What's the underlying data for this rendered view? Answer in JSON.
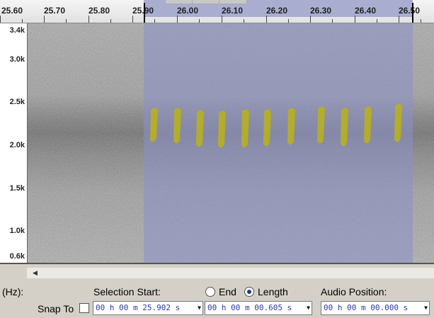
{
  "ruler": {
    "ticks": [
      "25.60",
      "25.70",
      "25.80",
      "25.90",
      "26.00",
      "26.10",
      "26.20",
      "26.30",
      "26.40",
      "26.50"
    ]
  },
  "track": {
    "freq_labels": [
      "3.4k",
      "3.0k",
      "2.5k",
      "2.0k",
      "1.5k",
      "1.0k",
      "0.6k"
    ]
  },
  "selection_bar": {
    "rate_label": "(Hz):",
    "selection_start_label": "Selection Start:",
    "end_label": "End",
    "length_label": "Length",
    "audio_position_label": "Audio Position:",
    "snap_to_label": "Snap To",
    "selection_start_value": "00 h 00 m 25.902 s",
    "length_value": "00 h 00 m 00.605 s",
    "audio_position_value": "00 h 00 m 00.000 s",
    "end_selected": false,
    "length_selected": true,
    "snap_to_checked": false
  },
  "colors": {
    "selection": "#9ea3cc",
    "call_marks": "#b8b020"
  }
}
